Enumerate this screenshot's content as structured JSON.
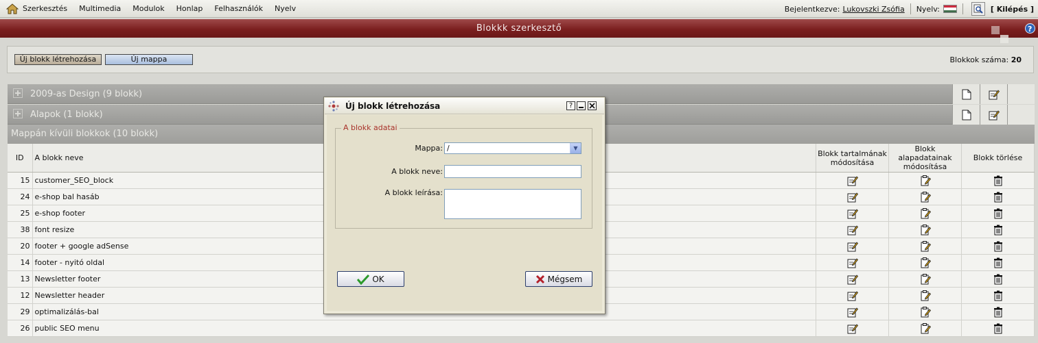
{
  "topbar": {
    "menu": [
      "Szerkesztés",
      "Multimedia",
      "Modulok",
      "Honlap",
      "Felhasználók",
      "Nyelv"
    ],
    "logged_in_label": "Bejelentkezve:",
    "user_name": "Lukovszki Zsófia",
    "language_label": "Nyelv:",
    "logout_label": "[ Kilépés ]"
  },
  "titlebar": {
    "title": "Blokkk szerkesztő"
  },
  "toolbar": {
    "new_block_label": "Új blokk létrehozása",
    "new_folder_label": "Új mappa",
    "count_label": "Blokkok száma:",
    "count_value": "20"
  },
  "folders": [
    {
      "name": "2009-as Design (9 blokk)"
    },
    {
      "name": "Alapok (1 blokk)"
    }
  ],
  "outside_folder": "Mappán kívüli blokkok (10 blokk)",
  "table": {
    "headers": {
      "id": "ID",
      "name": "A blokk neve",
      "edit_content": "Blokk tartalmának módosítása",
      "edit_basic": "Blokk alapadatainak módosítása",
      "delete": "Blokk törlése"
    },
    "rows": [
      {
        "id": "15",
        "name": "customer_SEO_block"
      },
      {
        "id": "24",
        "name": "e-shop bal hasáb"
      },
      {
        "id": "25",
        "name": "e-shop footer"
      },
      {
        "id": "38",
        "name": "font resize"
      },
      {
        "id": "20",
        "name": "footer + google adSense"
      },
      {
        "id": "14",
        "name": "footer - nyitó oldal"
      },
      {
        "id": "13",
        "name": "Newsletter footer"
      },
      {
        "id": "12",
        "name": "Newsletter header"
      },
      {
        "id": "29",
        "name": "optimalizálás-bal"
      },
      {
        "id": "26",
        "name": "public SEO menu"
      }
    ]
  },
  "dialog": {
    "title": "Új blokk létrehozása",
    "help_glyph": "?",
    "fieldset_legend": "A blokk adatai",
    "folder_label": "Mappa:",
    "folder_value": "/",
    "name_label": "A blokk neve:",
    "name_value": "",
    "desc_label": "A blokk leírása:",
    "desc_value": "",
    "ok_label": "OK",
    "cancel_label": "Mégsem"
  },
  "colors": {
    "titlebar": "#7b1f1f",
    "legend_text": "#a8322a",
    "folder_row": "#a4a4a1"
  },
  "icons": {
    "home": "home-icon",
    "search": "search-icon",
    "help": "help-icon",
    "folder_expand": "plus-icon",
    "new_page": "new-page-icon",
    "edit": "edit-icon",
    "edit_props": "clipboard-edit-icon",
    "delete": "trash-icon",
    "ok": "checkmark-icon",
    "cancel": "x-icon"
  }
}
